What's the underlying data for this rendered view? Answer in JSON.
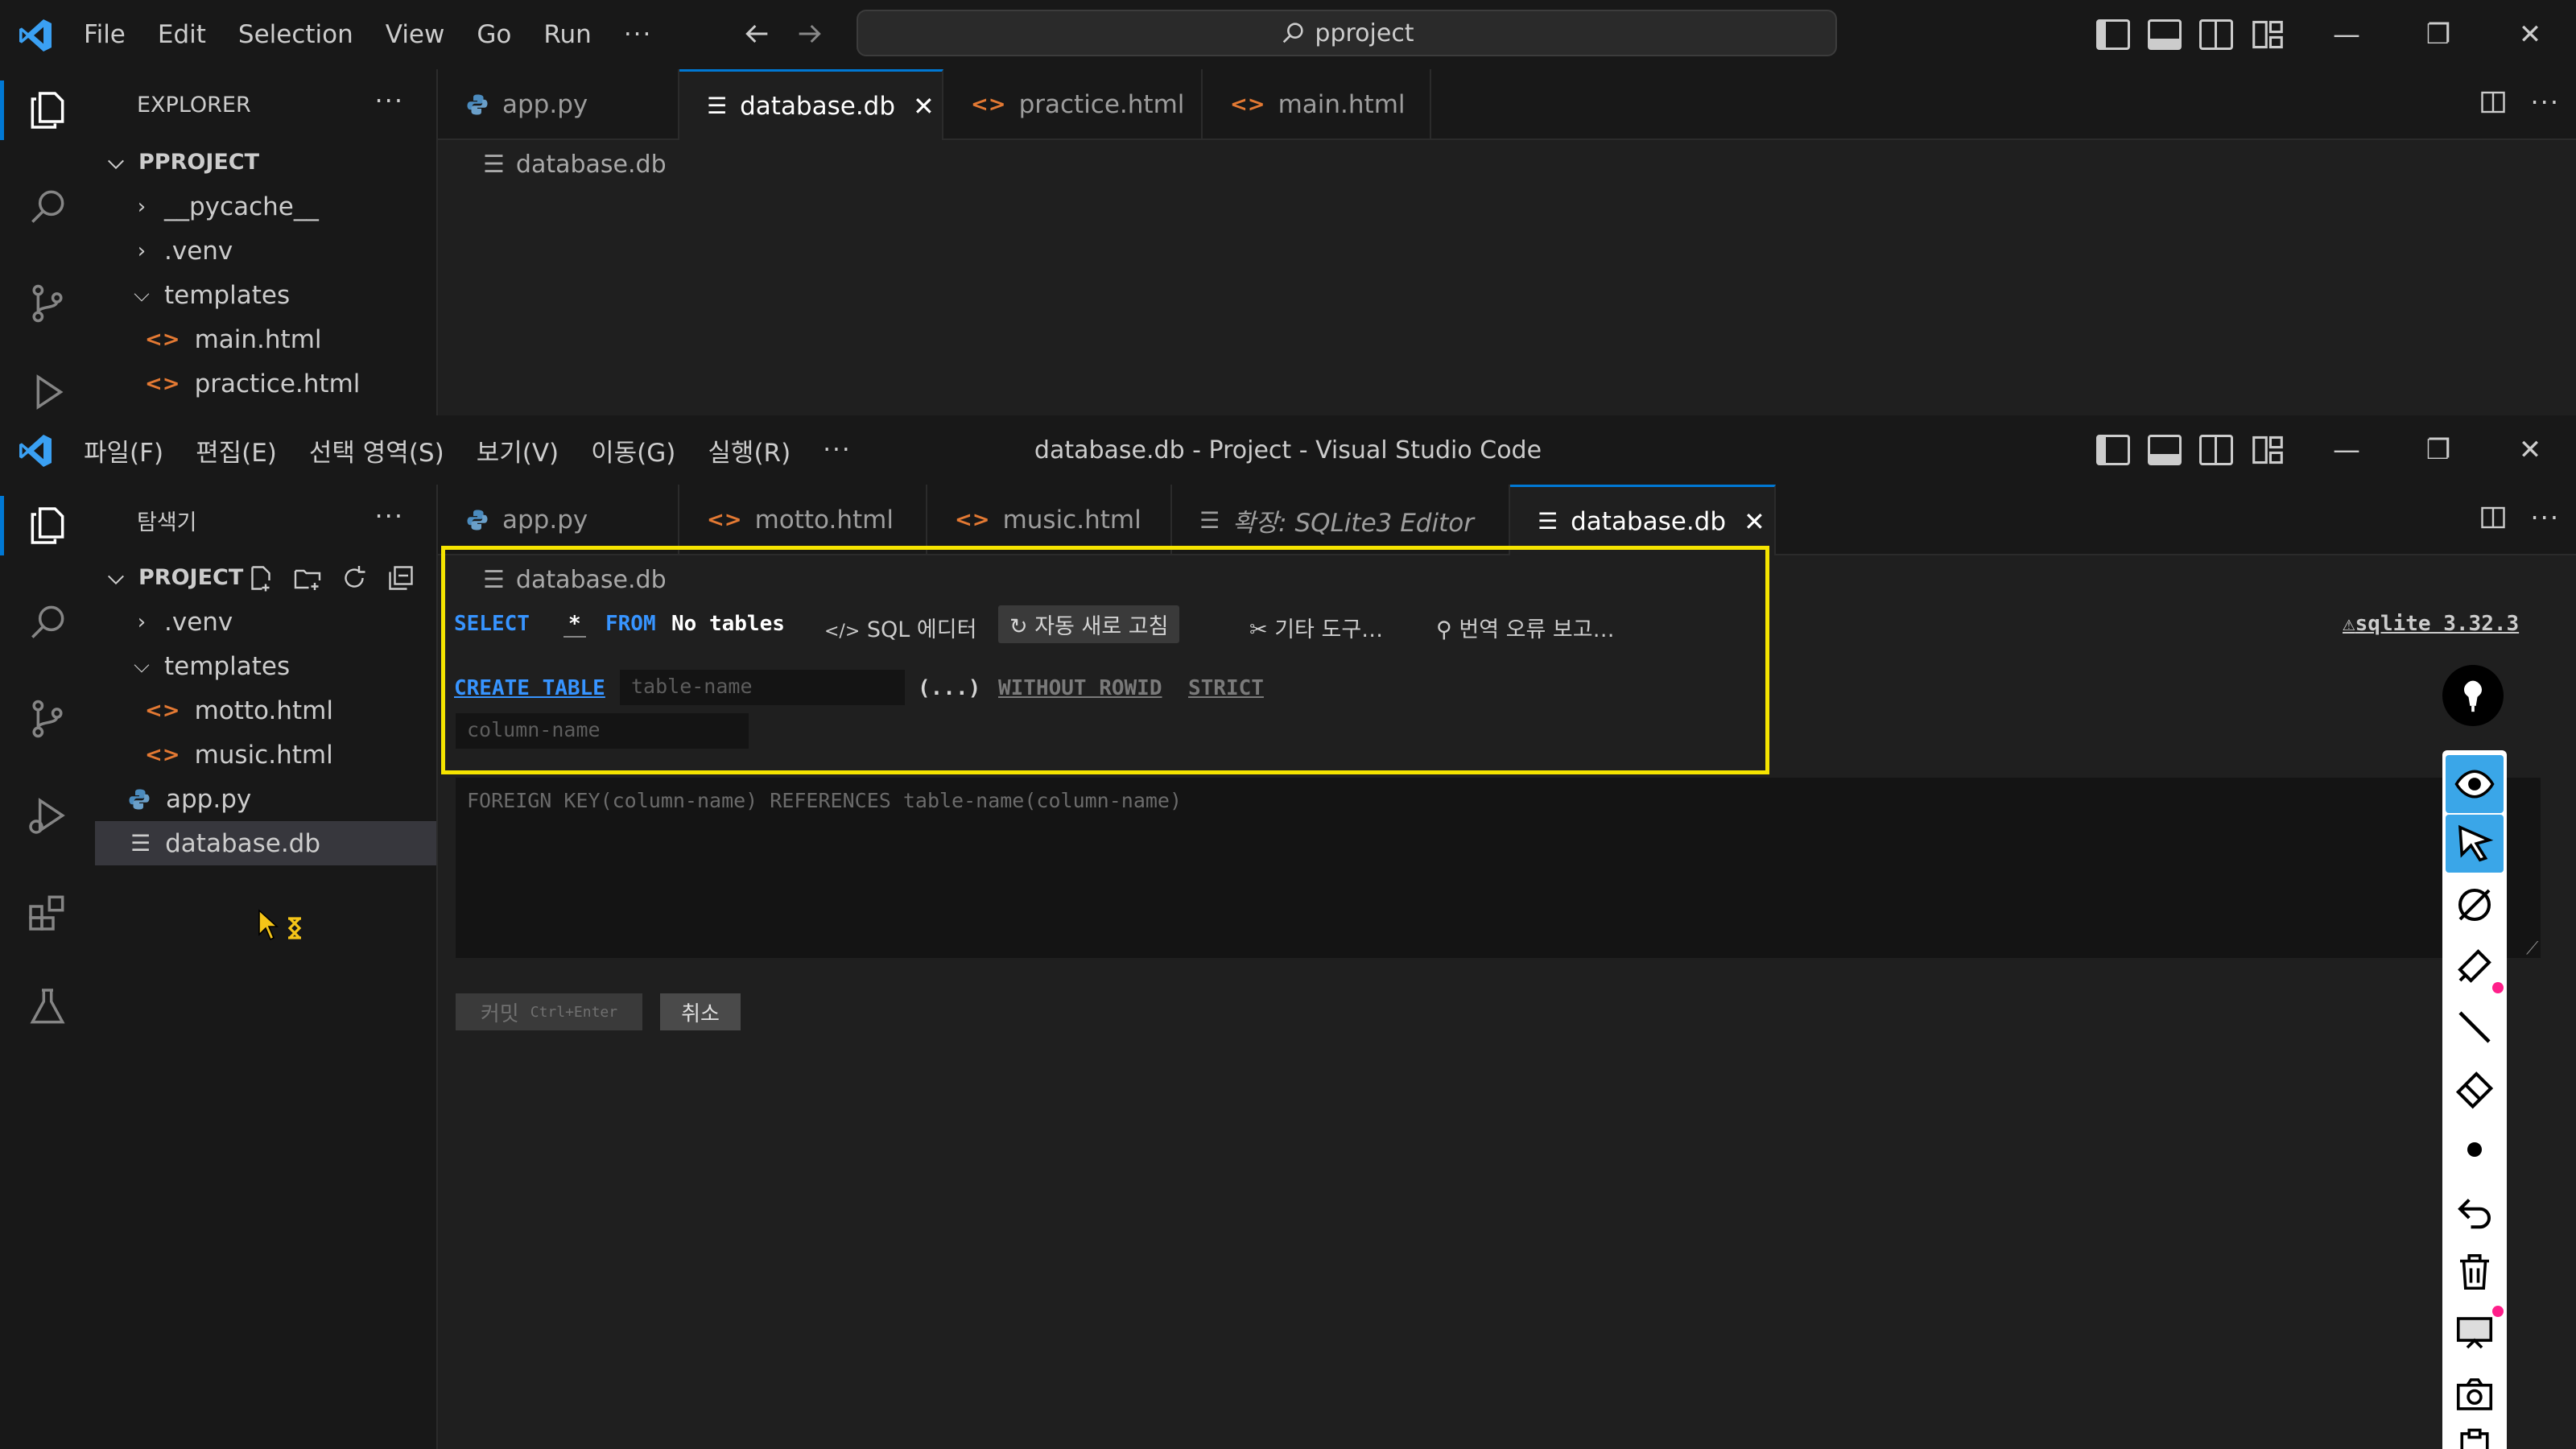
{
  "win1": {
    "menu": [
      "File",
      "Edit",
      "Selection",
      "View",
      "Go",
      "Run",
      "···"
    ],
    "search": "pproject",
    "explorer_title": "EXPLORER",
    "more": "···",
    "root": "PPROJECT",
    "tree": [
      {
        "label": "__pycache__",
        "kind": "folder-closed"
      },
      {
        "label": ".venv",
        "kind": "folder-closed"
      },
      {
        "label": "templates",
        "kind": "folder-open"
      },
      {
        "label": "main.html",
        "kind": "html"
      },
      {
        "label": "practice.html",
        "kind": "html"
      }
    ],
    "tabs": [
      {
        "label": "app.py",
        "icon": "python-icon"
      },
      {
        "label": "database.db",
        "icon": "db-file-icon",
        "active": true
      },
      {
        "label": "practice.html",
        "icon": "html-icon"
      },
      {
        "label": "main.html",
        "icon": "html-icon"
      }
    ],
    "breadcrumb": "database.db"
  },
  "win2": {
    "menu": [
      "파일(F)",
      "편집(E)",
      "선택 영역(S)",
      "보기(V)",
      "이동(G)",
      "실행(R)",
      "···"
    ],
    "title": "database.db - Project - Visual Studio Code",
    "explorer_title": "탐색기",
    "more": "···",
    "root": "PROJECT",
    "tree": [
      {
        "label": ".venv",
        "kind": "folder-closed"
      },
      {
        "label": "templates",
        "kind": "folder-open"
      },
      {
        "label": "motto.html",
        "kind": "html"
      },
      {
        "label": "music.html",
        "kind": "html"
      },
      {
        "label": "app.py",
        "kind": "python"
      },
      {
        "label": "database.db",
        "kind": "db",
        "selected": true
      }
    ],
    "tabs": [
      {
        "label": "app.py",
        "icon": "python-icon"
      },
      {
        "label": "motto.html",
        "icon": "html-icon"
      },
      {
        "label": "music.html",
        "icon": "html-icon"
      },
      {
        "label": "확장: SQLite3 Editor",
        "icon": "preview-icon",
        "italic": true
      },
      {
        "label": "database.db",
        "icon": "db-file-icon",
        "active": true
      }
    ],
    "breadcrumb": "database.db",
    "sqlite": {
      "select_kw": "SELECT",
      "star": "*",
      "from_kw": "FROM",
      "no_tables": "No tables",
      "sql_editor": "SQL 에디터",
      "auto_refresh": "자동 새로 고침",
      "other_tools": "기타 도구…",
      "report_translation": "번역 오류 보고…",
      "version": "sqlite 3.32.3",
      "create_table": "CREATE TABLE",
      "table_name_placeholder": "table-name",
      "parens": "(...)",
      "without_rowid": "WITHOUT ROWID",
      "strict": "STRICT",
      "column_name_placeholder": "column-name",
      "fk_placeholder": "FOREIGN KEY(column-name) REFERENCES table-name(column-name)",
      "commit": "커밋",
      "commit_shortcut": "Ctrl+Enter",
      "cancel": "취소"
    }
  },
  "colors": {
    "accent": "#0078d4",
    "highlight": "#f5e400",
    "keyword": "#3794ff",
    "html_icon": "#e37933"
  }
}
